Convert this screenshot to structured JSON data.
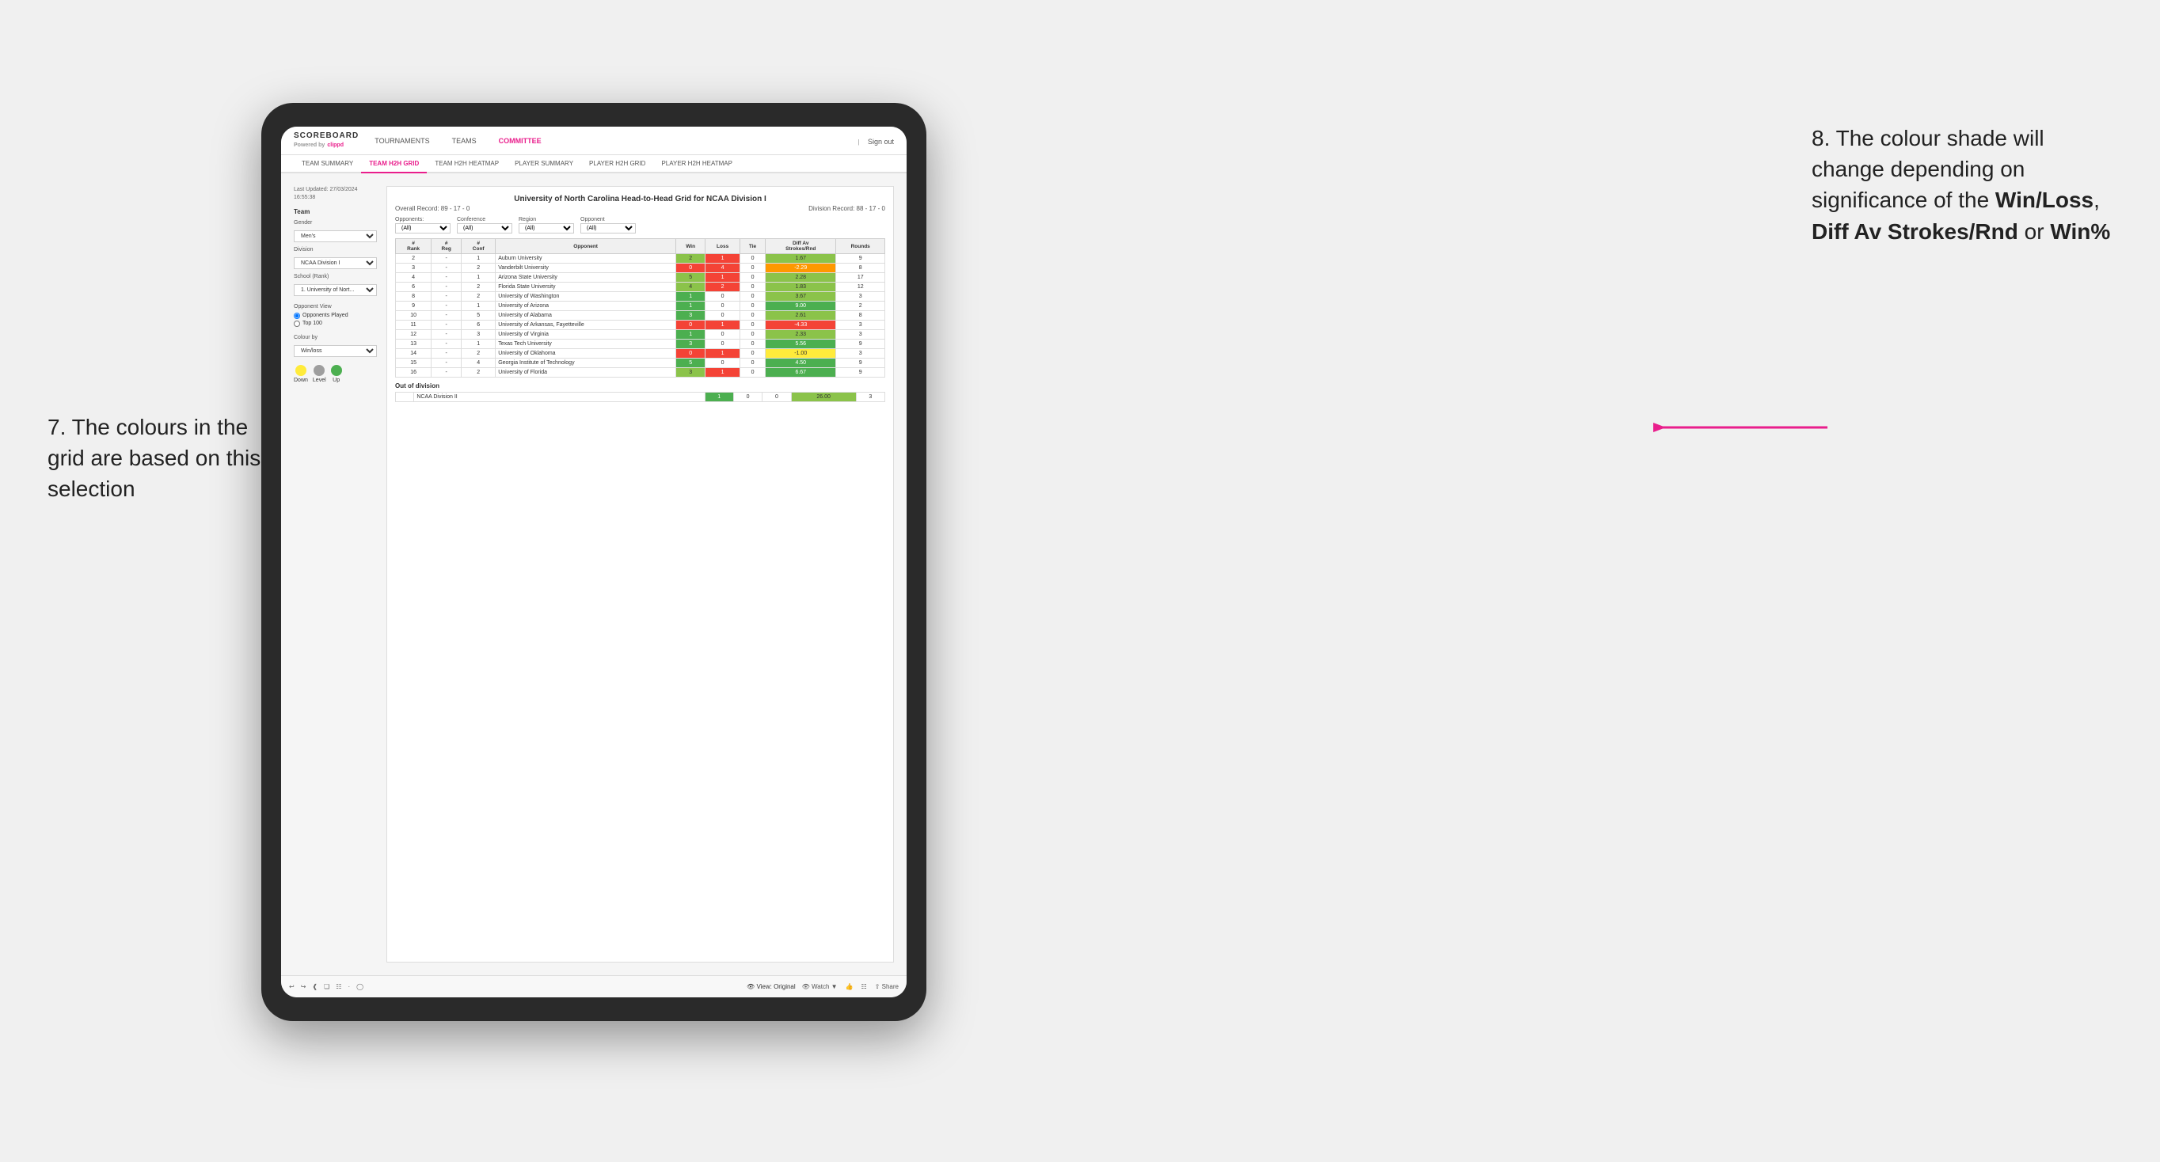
{
  "annotations": {
    "left_text": "7. The colours in the grid are based on this selection",
    "right_text_parts": [
      "8. The colour shade will change depending on significance of the ",
      "Win/Loss",
      ", ",
      "Diff Av Strokes/Rnd",
      " or ",
      "Win%"
    ]
  },
  "app": {
    "logo": "SCOREBOARD",
    "powered_by": "Powered by",
    "company": "clippd",
    "sign_out": "Sign out",
    "nav": [
      "TOURNAMENTS",
      "TEAMS",
      "COMMITTEE"
    ],
    "active_nav": "COMMITTEE"
  },
  "sub_nav": [
    "TEAM SUMMARY",
    "TEAM H2H GRID",
    "TEAM H2H HEATMAP",
    "PLAYER SUMMARY",
    "PLAYER H2H GRID",
    "PLAYER H2H HEATMAP"
  ],
  "active_sub_nav": "TEAM H2H GRID",
  "sidebar": {
    "timestamp": "Last Updated: 27/03/2024\n16:55:38",
    "team_label": "Team",
    "gender_label": "Gender",
    "gender_value": "Men's",
    "division_label": "Division",
    "division_value": "NCAA Division I",
    "school_label": "School (Rank)",
    "school_value": "1. University of Nort...",
    "opponent_view_label": "Opponent View",
    "opponent_options": [
      "Opponents Played",
      "Top 100"
    ],
    "colour_by_label": "Colour by",
    "colour_by_value": "Win/loss",
    "legend": {
      "down_label": "Down",
      "level_label": "Level",
      "up_label": "Up"
    }
  },
  "grid": {
    "title": "University of North Carolina Head-to-Head Grid for NCAA Division I",
    "overall_record": "Overall Record: 89 - 17 - 0",
    "division_record": "Division Record: 88 - 17 - 0",
    "filters": {
      "opponents_label": "Opponents:",
      "opponents_value": "(All)",
      "conference_label": "Conference",
      "conference_value": "(All)",
      "region_label": "Region",
      "region_value": "(All)",
      "opponent_label": "Opponent",
      "opponent_value": "(All)"
    },
    "columns": [
      "#\nRank",
      "#\nReg",
      "#\nConf",
      "Opponent",
      "Win",
      "Loss",
      "Tie",
      "Diff Av\nStrokes/Rnd",
      "Rounds"
    ],
    "rows": [
      {
        "rank": "2",
        "reg": "-",
        "conf": "1",
        "opponent": "Auburn University",
        "win": "2",
        "loss": "1",
        "tie": "0",
        "diff": "1.67",
        "rounds": "9"
      },
      {
        "rank": "3",
        "reg": "-",
        "conf": "2",
        "opponent": "Vanderbilt University",
        "win": "0",
        "loss": "4",
        "tie": "0",
        "diff": "-2.29",
        "rounds": "8"
      },
      {
        "rank": "4",
        "reg": "-",
        "conf": "1",
        "opponent": "Arizona State University",
        "win": "5",
        "loss": "1",
        "tie": "0",
        "diff": "2.28",
        "rounds": "17"
      },
      {
        "rank": "6",
        "reg": "-",
        "conf": "2",
        "opponent": "Florida State University",
        "win": "4",
        "loss": "2",
        "tie": "0",
        "diff": "1.83",
        "rounds": "12"
      },
      {
        "rank": "8",
        "reg": "-",
        "conf": "2",
        "opponent": "University of Washington",
        "win": "1",
        "loss": "0",
        "tie": "0",
        "diff": "3.67",
        "rounds": "3"
      },
      {
        "rank": "9",
        "reg": "-",
        "conf": "1",
        "opponent": "University of Arizona",
        "win": "1",
        "loss": "0",
        "tie": "0",
        "diff": "9.00",
        "rounds": "2"
      },
      {
        "rank": "10",
        "reg": "-",
        "conf": "5",
        "opponent": "University of Alabama",
        "win": "3",
        "loss": "0",
        "tie": "0",
        "diff": "2.61",
        "rounds": "8"
      },
      {
        "rank": "11",
        "reg": "-",
        "conf": "6",
        "opponent": "University of Arkansas, Fayetteville",
        "win": "0",
        "loss": "1",
        "tie": "0",
        "diff": "-4.33",
        "rounds": "3"
      },
      {
        "rank": "12",
        "reg": "-",
        "conf": "3",
        "opponent": "University of Virginia",
        "win": "1",
        "loss": "0",
        "tie": "0",
        "diff": "2.33",
        "rounds": "3"
      },
      {
        "rank": "13",
        "reg": "-",
        "conf": "1",
        "opponent": "Texas Tech University",
        "win": "3",
        "loss": "0",
        "tie": "0",
        "diff": "5.56",
        "rounds": "9"
      },
      {
        "rank": "14",
        "reg": "-",
        "conf": "2",
        "opponent": "University of Oklahoma",
        "win": "0",
        "loss": "1",
        "tie": "0",
        "diff": "-1.00",
        "rounds": "3"
      },
      {
        "rank": "15",
        "reg": "-",
        "conf": "4",
        "opponent": "Georgia Institute of Technology",
        "win": "5",
        "loss": "0",
        "tie": "0",
        "diff": "4.50",
        "rounds": "9"
      },
      {
        "rank": "16",
        "reg": "-",
        "conf": "2",
        "opponent": "University of Florida",
        "win": "3",
        "loss": "1",
        "tie": "0",
        "diff": "6.67",
        "rounds": "9"
      }
    ],
    "out_of_division_label": "Out of division",
    "out_of_division_rows": [
      {
        "opponent": "NCAA Division II",
        "win": "1",
        "loss": "0",
        "tie": "0",
        "diff": "26.00",
        "rounds": "3"
      }
    ]
  },
  "toolbar": {
    "view_label": "View: Original",
    "watch_label": "Watch",
    "share_label": "Share"
  },
  "colors": {
    "pink": "#e91e8c",
    "green_dark": "#4caf50",
    "green_mid": "#8bc34a",
    "yellow": "#ffeb3b",
    "grey_dot": "#9e9e9e"
  }
}
